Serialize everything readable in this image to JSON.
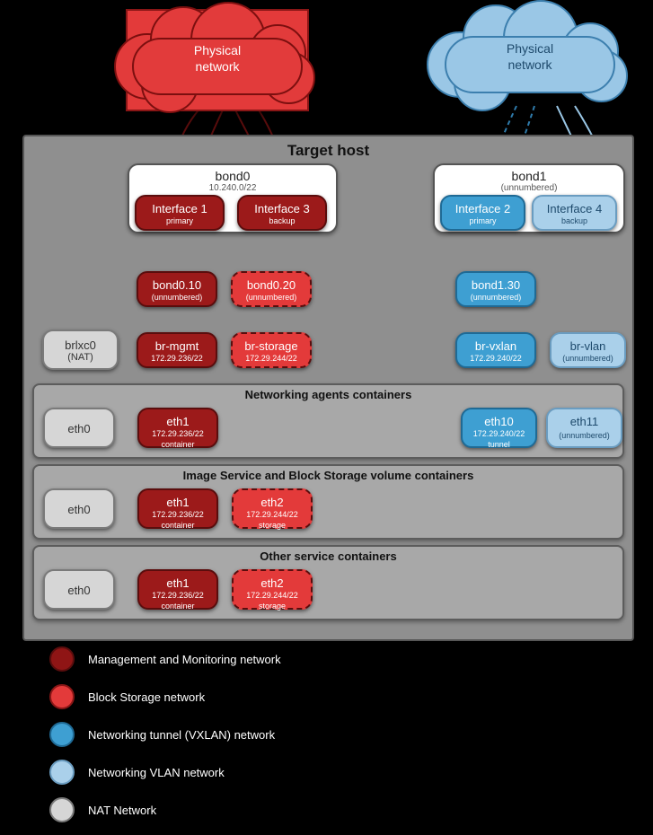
{
  "clouds": {
    "left": "Physical\nnetwork",
    "right": "Physical\nnetwork"
  },
  "host": {
    "title": "Target host"
  },
  "bonds": {
    "bond0": {
      "name": "bond0",
      "sub": "10.240.0/22"
    },
    "bond1": {
      "name": "bond1",
      "sub": "(unnumbered)"
    }
  },
  "ifaces": {
    "if1": {
      "name": "Interface 1",
      "sub": "primary"
    },
    "if3": {
      "name": "Interface 3",
      "sub": "backup"
    },
    "if2": {
      "name": "Interface 2",
      "sub": "primary"
    },
    "if4": {
      "name": "Interface 4",
      "sub": "backup"
    }
  },
  "vlans": {
    "b010": {
      "name": "bond0.10",
      "sub": "(unnumbered)"
    },
    "b020": {
      "name": "bond0.20",
      "sub": "(unnumbered)"
    },
    "b130": {
      "name": "bond1.30",
      "sub": "(unnumbered)"
    }
  },
  "bridges": {
    "brlxc0": {
      "name": "brlxc0",
      "sub": "(NAT)"
    },
    "brmgmt": {
      "name": "br-mgmt",
      "sub": "172.29.236/22"
    },
    "brstorage": {
      "name": "br-storage",
      "sub": "172.29.244/22"
    },
    "brvxlan": {
      "name": "br-vxlan",
      "sub": "172.29.240/22"
    },
    "brvlan": {
      "name": "br-vlan",
      "sub": "(unnumbered)"
    }
  },
  "sections": {
    "net": {
      "title": "Networking agents containers"
    },
    "image": {
      "title": "Image Service and Block Storage volume containers"
    },
    "other": {
      "title": "Other service containers"
    }
  },
  "eth": {
    "net": {
      "eth0": {
        "name": "eth0"
      },
      "eth1": {
        "name": "eth1",
        "sub1": "172.29.236/22",
        "sub2": "container"
      },
      "eth10": {
        "name": "eth10",
        "sub1": "172.29.240/22",
        "sub2": "tunnel"
      },
      "eth11": {
        "name": "eth11",
        "sub1": "(unnumbered)"
      }
    },
    "image": {
      "eth0": {
        "name": "eth0"
      },
      "eth1": {
        "name": "eth1",
        "sub1": "172.29.236/22",
        "sub2": "container"
      },
      "eth2": {
        "name": "eth2",
        "sub1": "172.29.244/22",
        "sub2": "storage"
      }
    },
    "other": {
      "eth0": {
        "name": "eth0"
      },
      "eth1": {
        "name": "eth1",
        "sub1": "172.29.236/22",
        "sub2": "container"
      },
      "eth2": {
        "name": "eth2",
        "sub1": "172.29.244/22",
        "sub2": "storage"
      }
    }
  },
  "legend": [
    {
      "color": "darkred",
      "text": "Management and Monitoring network"
    },
    {
      "color": "red",
      "text": "Block Storage network"
    },
    {
      "color": "midblue",
      "text": "Networking tunnel (VXLAN) network"
    },
    {
      "color": "lightblue",
      "text": "Networking VLAN network"
    },
    {
      "color": "gray",
      "text": "NAT Network"
    }
  ]
}
